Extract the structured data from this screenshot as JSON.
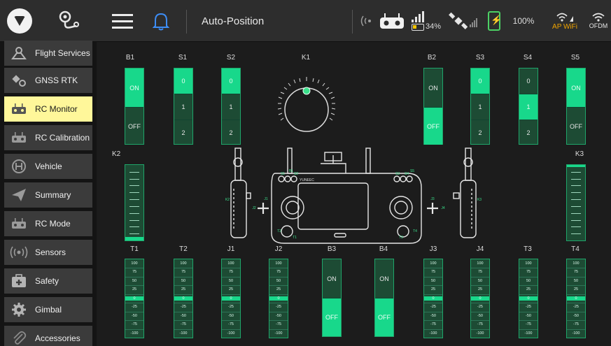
{
  "topbar": {
    "title": "Auto-Position",
    "rc_battery": "34%",
    "drone_battery": "100%",
    "wifi_label": "AP WiFi",
    "ofdm_label": "OFDM",
    "accent_color": "#18d88b"
  },
  "sidebar": {
    "items": [
      {
        "label": "Flight Services",
        "icon": "drone-icon"
      },
      {
        "label": "GNSS RTK",
        "icon": "satellite-gear-icon"
      },
      {
        "label": "RC Monitor",
        "icon": "remote-controller-icon",
        "active": true
      },
      {
        "label": "RC Calibration",
        "icon": "remote-controller-icon"
      },
      {
        "label": "Vehicle",
        "icon": "vehicle-icon"
      },
      {
        "label": "Summary",
        "icon": "paper-plane-icon"
      },
      {
        "label": "RC Mode",
        "icon": "remote-controller-icon"
      },
      {
        "label": "Sensors",
        "icon": "sensor-icon"
      },
      {
        "label": "Safety",
        "icon": "first-aid-icon"
      },
      {
        "label": "Gimbal",
        "icon": "gear-icon"
      },
      {
        "label": "Accessories",
        "icon": "paperclip-icon"
      }
    ]
  },
  "switches_top": [
    {
      "label": "B1",
      "segments": [
        "ON",
        "OFF"
      ],
      "active": 0
    },
    {
      "label": "S1",
      "segments": [
        "0",
        "1",
        "2"
      ],
      "active": 0
    },
    {
      "label": "S2",
      "segments": [
        "0",
        "1",
        "2"
      ],
      "active": 0
    },
    {
      "label": "B2",
      "segments": [
        "ON",
        "OFF"
      ],
      "active": 1
    },
    {
      "label": "S3",
      "segments": [
        "0",
        "1",
        "2"
      ],
      "active": 0
    },
    {
      "label": "S4",
      "segments": [
        "0",
        "1",
        "2"
      ],
      "active": 1
    },
    {
      "label": "S5",
      "segments": [
        "ON",
        "OFF"
      ],
      "active": 0
    }
  ],
  "knob": {
    "label": "K1"
  },
  "side_bars": [
    {
      "label": "K2",
      "level": 0.05
    },
    {
      "label": "K3",
      "level": 0.97
    }
  ],
  "bottom_labels": [
    "T1",
    "T2",
    "J1",
    "J2",
    "B3",
    "B4",
    "J3",
    "J4",
    "T3",
    "T4"
  ],
  "bottom_switches": {
    "B3": {
      "segments": [
        "ON",
        "OFF"
      ],
      "active": 1
    },
    "B4": {
      "segments": [
        "ON",
        "OFF"
      ],
      "active": 1
    }
  },
  "scale_values": [
    "100",
    "75",
    "50",
    "25",
    "0",
    "-25",
    "-50",
    "-75",
    "-100"
  ],
  "rc_diagram": {
    "brand": "YUNEEC",
    "labels": {
      "B1": "B1",
      "S5": "S5",
      "S1": "S1",
      "S2": "S2",
      "S3": "S3",
      "S4": "S4",
      "K2": "K2",
      "K3": "K3",
      "J1": "J1",
      "J2": "J2",
      "J3": "J3",
      "J4": "J4",
      "T1": "T1",
      "T2": "T2",
      "T3": "T3",
      "T4": "T4"
    }
  }
}
